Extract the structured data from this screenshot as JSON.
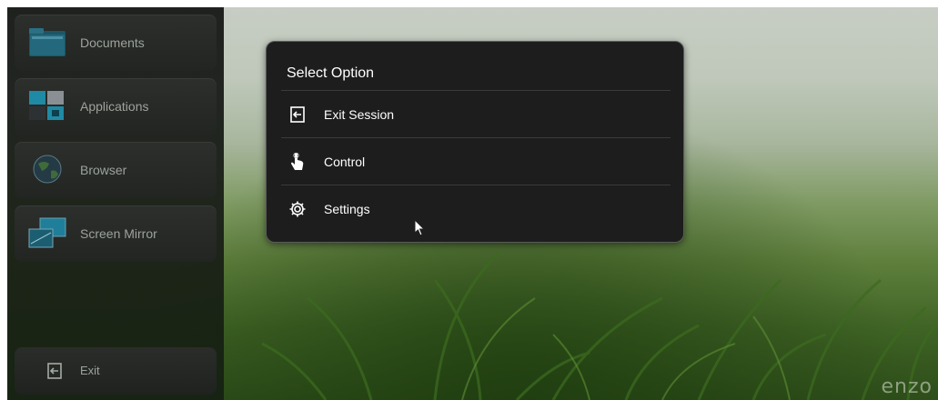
{
  "sidebar": {
    "items": [
      {
        "label": "Documents",
        "icon": "folder-icon"
      },
      {
        "label": "Applications",
        "icon": "apps-grid-icon"
      },
      {
        "label": "Browser",
        "icon": "globe-icon"
      },
      {
        "label": "Screen Mirror",
        "icon": "screen-mirror-icon"
      }
    ],
    "exit_label": "Exit"
  },
  "dialog": {
    "title": "Select Option",
    "options": [
      {
        "label": "Exit Session",
        "icon": "exit-icon"
      },
      {
        "label": "Control",
        "icon": "hand-pointer-icon"
      },
      {
        "label": "Settings",
        "icon": "gear-icon"
      }
    ]
  },
  "brand": "enzo"
}
